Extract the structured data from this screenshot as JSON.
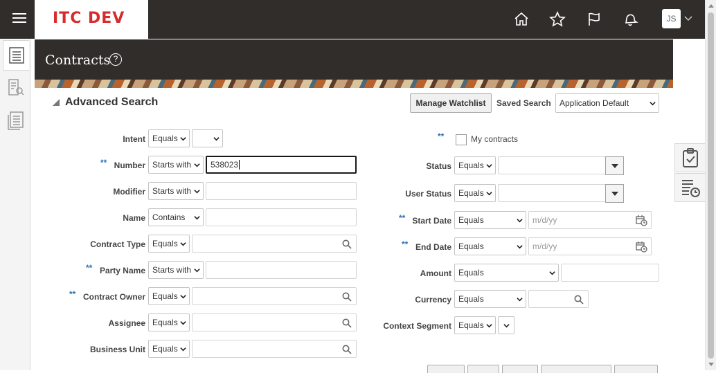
{
  "app": {
    "brand": "ITC DEV",
    "user_initials": "JS"
  },
  "page": {
    "title": "Contracts"
  },
  "search": {
    "section_title": "Advanced Search",
    "manage_watchlist": "Manage Watchlist",
    "saved_search_label": "Saved Search",
    "saved_search_value": "Application Default",
    "required_marker": "**",
    "left_fields": {
      "intent": {
        "label": "Intent",
        "op": "Equals",
        "value": ""
      },
      "number": {
        "label": "Number",
        "op": "Starts with",
        "value": "538023"
      },
      "modifier": {
        "label": "Modifier",
        "op": "Starts with",
        "value": ""
      },
      "name": {
        "label": "Name",
        "op": "Contains",
        "value": ""
      },
      "contract_type": {
        "label": "Contract Type",
        "op": "Equals",
        "value": ""
      },
      "party_name": {
        "label": "Party Name",
        "op": "Starts with",
        "value": ""
      },
      "contract_owner": {
        "label": "Contract Owner",
        "op": "Equals",
        "value": ""
      },
      "assignee": {
        "label": "Assignee",
        "op": "Equals",
        "value": ""
      },
      "business_unit": {
        "label": "Business Unit",
        "op": "Equals",
        "value": ""
      }
    },
    "right_fields": {
      "my_contracts": {
        "label": "My contracts"
      },
      "status": {
        "label": "Status",
        "op": "Equals",
        "value": ""
      },
      "user_status": {
        "label": "User Status",
        "op": "Equals",
        "value": ""
      },
      "start_date": {
        "label": "Start Date",
        "op": "Equals",
        "placeholder": "m/d/yy"
      },
      "end_date": {
        "label": "End Date",
        "op": "Equals",
        "placeholder": "m/d/yy"
      },
      "amount": {
        "label": "Amount",
        "op": "Equals",
        "value": ""
      },
      "currency": {
        "label": "Currency",
        "op": "Equals",
        "value": ""
      },
      "context_segment": {
        "label": "Context Segment",
        "op": "Equals",
        "value": ""
      }
    }
  },
  "colors": {
    "header_bg": "#312d2a",
    "brand_red": "#d62c2c",
    "required_blue": "#2b6fb0"
  }
}
